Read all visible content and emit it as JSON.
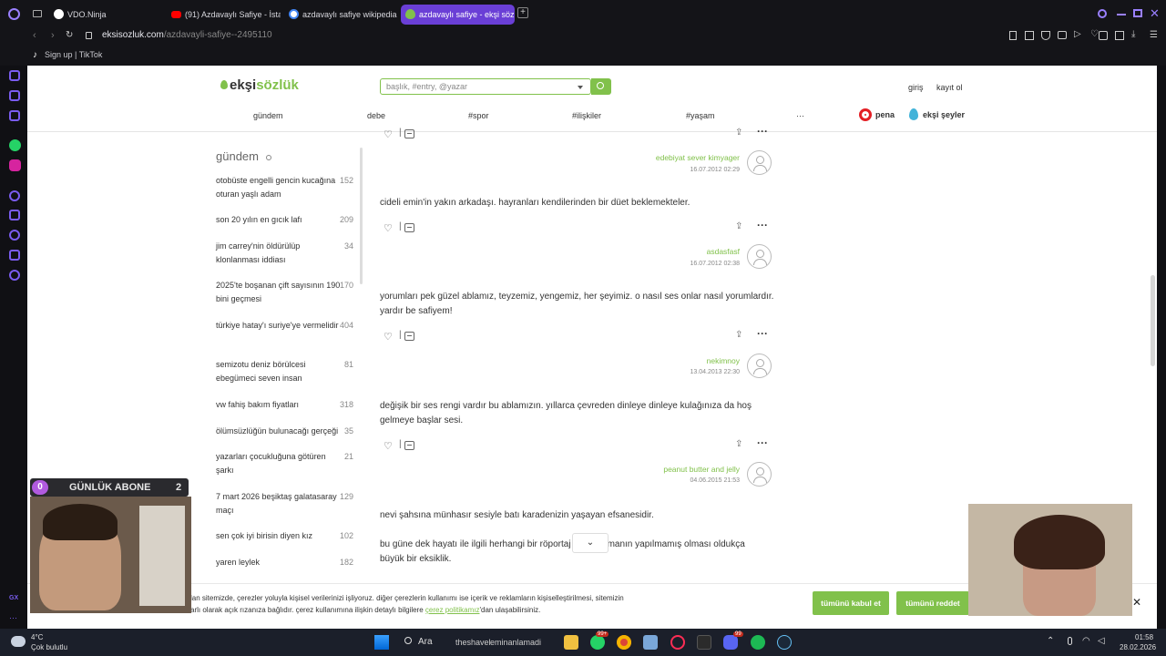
{
  "browser": {
    "tabs": [
      {
        "label": "VDO.Ninja"
      },
      {
        "label": "(91) Azdavaylı Safiye - İsta"
      },
      {
        "label": "azdavaylı safiye wikipedia"
      },
      {
        "label": "azdavaylı safiye - ekşi söz"
      }
    ],
    "url_host": "eksisozluk.com",
    "url_path": "/azdavayli-safiye--2495110",
    "bookmark": "Sign up | TikTok"
  },
  "site": {
    "logo_a": "ekşi",
    "logo_b": "sözlük",
    "search_placeholder": "başlık, #entry, @yazar",
    "login": "giriş",
    "register": "kayıt ol",
    "nav": [
      "gündem",
      "debe",
      "#spor",
      "#ilişkiler",
      "#yaşam",
      "···"
    ],
    "pena": "pena",
    "eksi_seyler": "ekşi şeyler"
  },
  "gundem": {
    "title": "gündem",
    "items": [
      {
        "title": "otobüste engelli gencin kucağına oturan yaşlı adam",
        "count": "152"
      },
      {
        "title": "son 20 yılın en gıcık lafı",
        "count": "209"
      },
      {
        "title": "jim carrey'nin öldürülüp klonlanması iddiası",
        "count": "34"
      },
      {
        "title": "2025'te boşanan çift sayısının 190 bini geçmesi",
        "count": "170"
      },
      {
        "title": "türkiye hatay'ı suriye'ye vermelidir",
        "count": "404"
      },
      {
        "title": "semizotu deniz börülcesi ebegümeci seven insan",
        "count": "81"
      },
      {
        "title": "vw fahiş bakım fiyatları",
        "count": "318"
      },
      {
        "title": "ölümsüzlüğün bulunacağı gerçeği",
        "count": "35"
      },
      {
        "title": "yazarları çocukluğuna götüren şarkı",
        "count": "21"
      },
      {
        "title": "7 mart 2026 beşiktaş galatasaray maçı",
        "count": "129"
      },
      {
        "title": "sen çok iyi birisin diyen kız",
        "count": "102"
      },
      {
        "title": "yaren leylek",
        "count": "182"
      }
    ]
  },
  "entries": [
    {
      "author": "edebiyat sever kimyager",
      "date": "16.07.2012 02:29"
    },
    {
      "text": "cideli emin'in yakın arkadaşı. hayranları kendilerinden bir düet beklemekteler.",
      "author": "asdasfasf",
      "date": "16.07.2012 02:38"
    },
    {
      "text": "yorumları pek güzel ablamız, teyzemiz, yengemiz, her şeyimiz. o nasıl ses onlar nasıl yorumlardır. yardır be safiyem!",
      "author": "nekimnoy",
      "date": "13.04.2013 22:30"
    },
    {
      "text": "değişik bir ses rengi vardır bu ablamızın. yıllarca çevreden dinleye dinleye kulağınıza da hoş gelmeye başlar sesi.",
      "author": "peanut butter and jelly",
      "date": "04.06.2015 21:53"
    },
    {
      "text": "nevi şahsına münhasır sesiyle batı karadenizin yaşayan efsanesidir."
    },
    {
      "text_a": "bu güne dek hayatı ile ilgili herhangi bir röportaj",
      "text_b": "manın yapılmamış olması oldukça büyük bir eksiklik."
    }
  ],
  "cookie": {
    "line1": "lan sitemizde, çerezler yoluyla kişisel verilerinizi işliyoruz. diğer çerezlerin kullanımı ise içerik ve reklamların kişiselleştirilmesi, sitemizin",
    "line2a": "arlı olarak açık rızanıza bağlıdır. çerez kullanımına ilişkin detaylı bilgilere ",
    "link": "çerez politikamız",
    "line2b": "'dan ulaşabilirsiniz.",
    "accept": "tümünü kabul et",
    "reject": "tümünü reddet",
    "close": "✕"
  },
  "stream": {
    "badge_count": "0",
    "label": "GÜNLÜK ABONE",
    "value": "2"
  },
  "taskbar": {
    "weather_temp": "4°C",
    "weather_desc": "Çok bulutlu",
    "search": "Ara",
    "center_text_a": "theshavel",
    "center_text_b": "eminanlamadi",
    "time": "01:58",
    "date": "28.02.2026",
    "badge1": "99+",
    "badge2": "99",
    "sidebar_gx": "GX"
  },
  "colors": {
    "accent": "#81c14b",
    "opera": "#7a5cf0",
    "active_tab": "#6a3fd6"
  }
}
